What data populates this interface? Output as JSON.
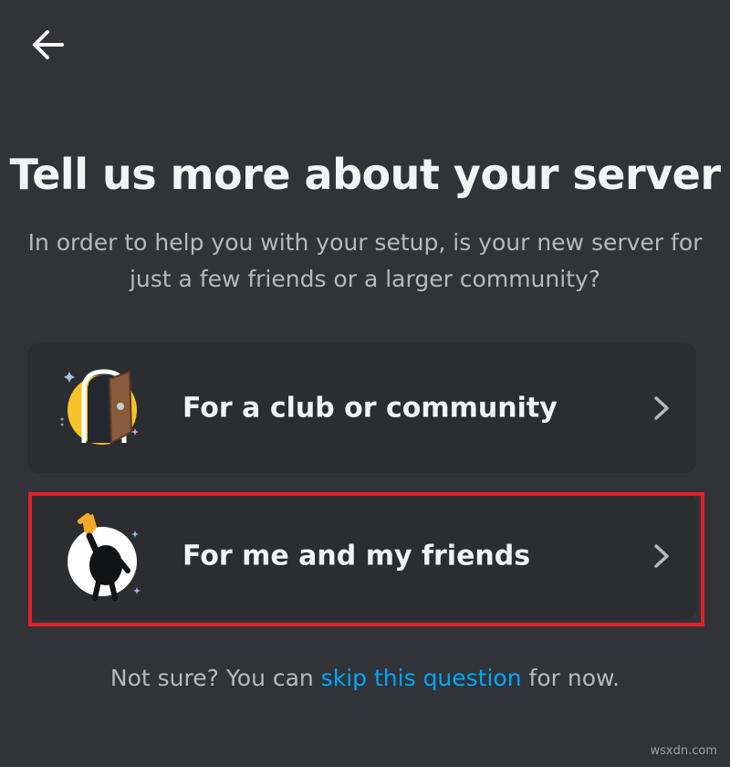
{
  "header": {
    "back_icon": "arrow-left-icon"
  },
  "title": "Tell us more about your server",
  "subtitle": "In order to help you with your setup, is your new server for just a few friends or a larger community?",
  "options": [
    {
      "label": "For a club or community",
      "illustration": "open-door-icon",
      "chevron": "chevron-right-icon"
    },
    {
      "label": "For me and my friends",
      "illustration": "waving-character-icon",
      "chevron": "chevron-right-icon"
    }
  ],
  "footer": {
    "prefix": "Not sure? You can ",
    "link": "skip this question",
    "suffix": " for now."
  },
  "watermark": "wsxdn.com",
  "colors": {
    "background": "#313338",
    "card": "#2b2d31",
    "title": "#f2f3f5",
    "muted_text": "#b5bac1",
    "link": "#00a8fc",
    "highlight": "#e02128",
    "illustration_yellow": "#f7c328"
  }
}
